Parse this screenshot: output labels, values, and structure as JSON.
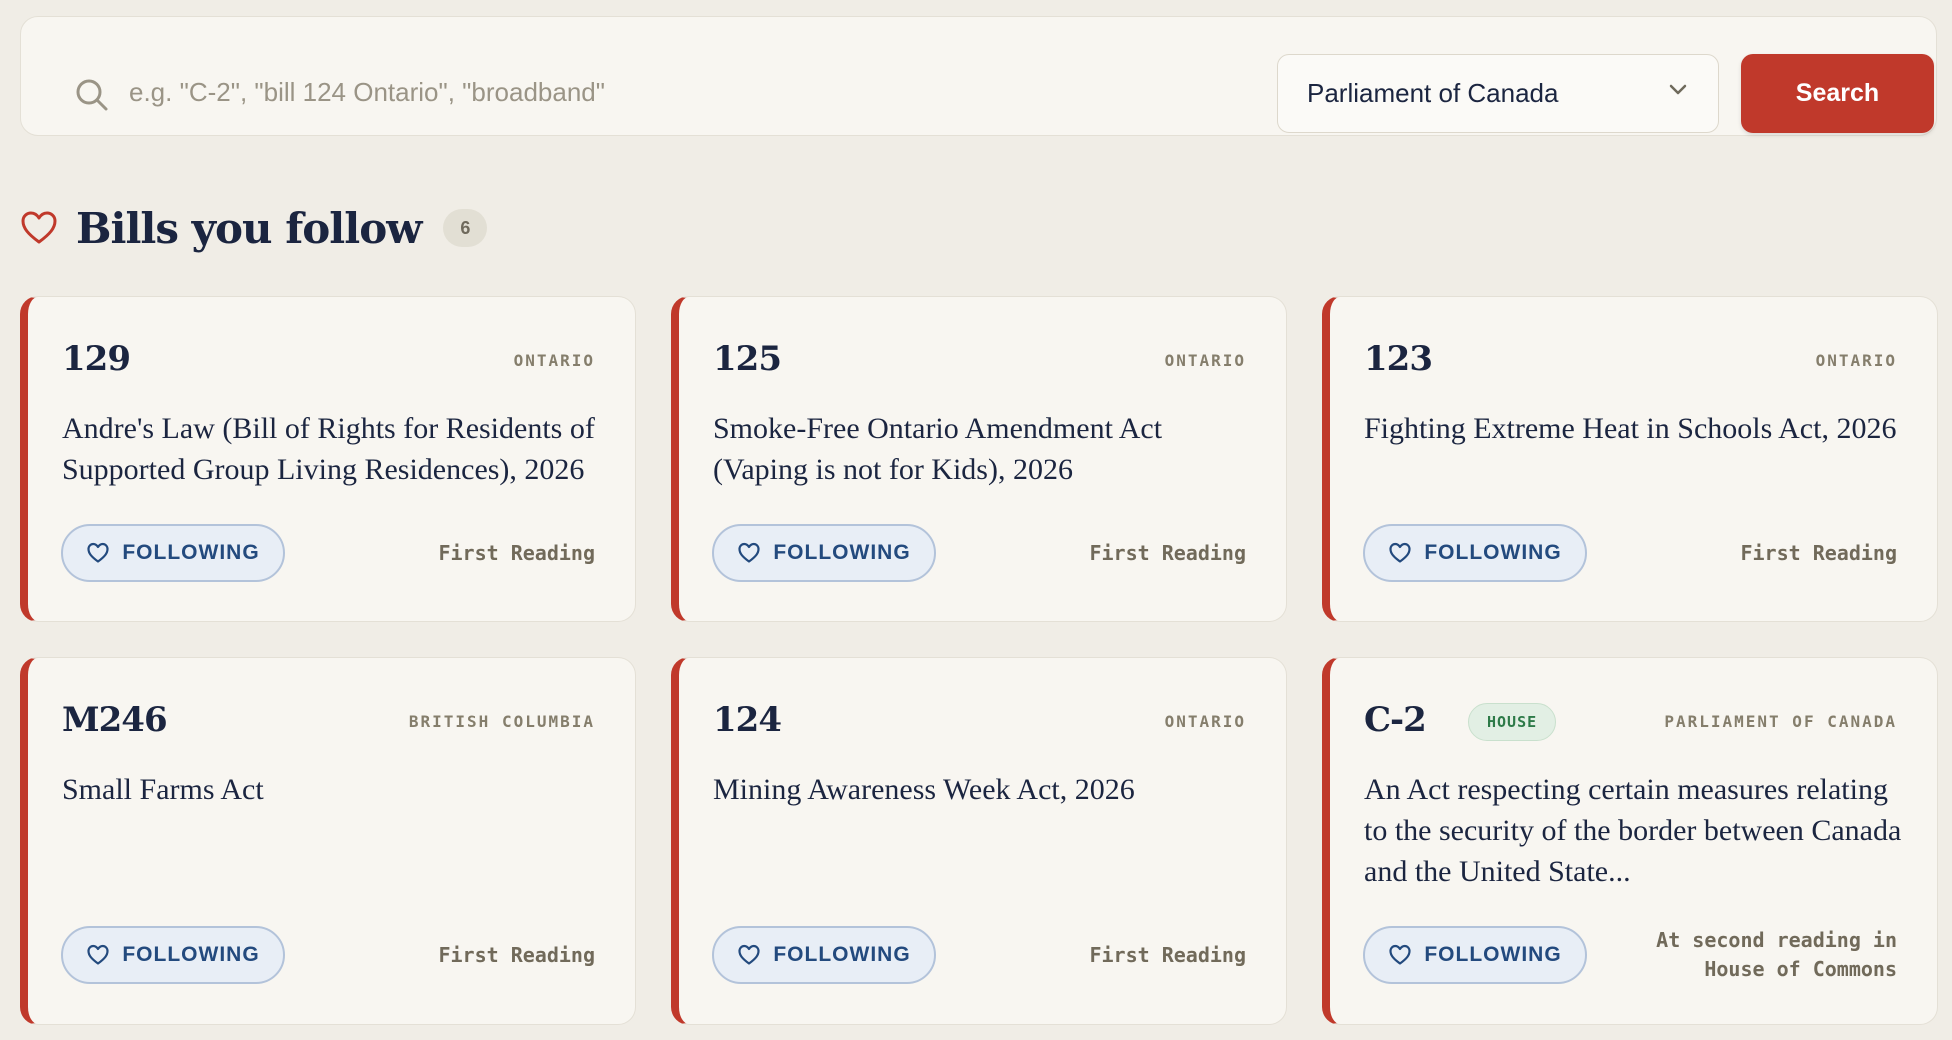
{
  "search": {
    "placeholder": "e.g. \"C-2\", \"bill 124 Ontario\", \"broadband\"",
    "value": "",
    "jurisdiction_selected": "Parliament of Canada",
    "button_label": "Search"
  },
  "section": {
    "title": "Bills you follow",
    "count": "6"
  },
  "bills": [
    {
      "number": "129",
      "jurisdiction": "ONTARIO",
      "title": "Andre's Law (Bill of Rights for Residents of Supported Group Living Residences), 2026",
      "follow_label": "FOLLOWING",
      "status": "First Reading"
    },
    {
      "number": "125",
      "jurisdiction": "ONTARIO",
      "title": "Smoke-Free Ontario Amendment Act (Vaping is not for Kids), 2026",
      "follow_label": "FOLLOWING",
      "status": "First Reading"
    },
    {
      "number": "123",
      "jurisdiction": "ONTARIO",
      "title": "Fighting Extreme Heat in Schools Act, 2026",
      "follow_label": "FOLLOWING",
      "status": "First Reading"
    },
    {
      "number": "M246",
      "jurisdiction": "BRITISH COLUMBIA",
      "title": "Small Farms Act",
      "follow_label": "FOLLOWING",
      "status": "First Reading"
    },
    {
      "number": "124",
      "jurisdiction": "ONTARIO",
      "title": "Mining Awareness Week Act, 2026",
      "follow_label": "FOLLOWING",
      "status": "First Reading"
    },
    {
      "number": "C-2",
      "chamber_badge": "HOUSE",
      "jurisdiction": "PARLIAMENT OF CANADA",
      "title": "An Act respecting certain measures relating to the security of the border between Canada and the United State...",
      "follow_label": "FOLLOWING",
      "status_line1": "At second reading in",
      "status_line2": "House of Commons"
    }
  ],
  "colors": {
    "accent_red": "#c0392b",
    "page_bg": "#f0ede6",
    "card_bg": "#f8f6f1",
    "following_blue": "#234a7e",
    "house_green": "#2d7a48"
  },
  "icons": {
    "search": "search-icon",
    "select": "chevron-down-icon",
    "heading": "heart-outline-icon",
    "follow": "heart-outline-icon"
  }
}
